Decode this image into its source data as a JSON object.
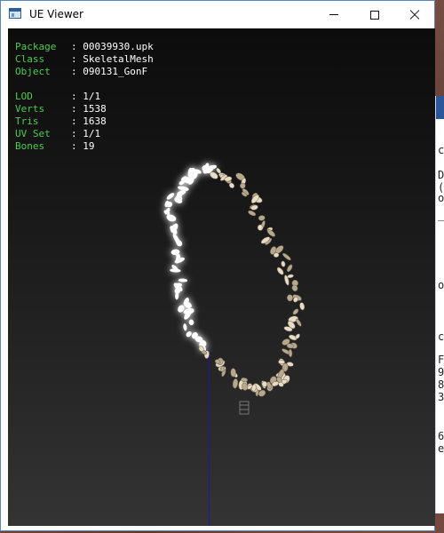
{
  "window": {
    "title": "UE Viewer",
    "controls": {
      "minimize": "minimize",
      "maximize": "maximize",
      "close": "close"
    }
  },
  "info": {
    "package": {
      "label": "Package",
      "value": "00039930.upk"
    },
    "class": {
      "label": "Class",
      "value": "SkeletalMesh"
    },
    "object": {
      "label": "Object",
      "value": "090131_GonF"
    },
    "lod": {
      "label": "LOD",
      "value": "1/1"
    },
    "verts": {
      "label": "Verts",
      "value": "1538"
    },
    "tris": {
      "label": "Tris",
      "value": "1638"
    },
    "uvset": {
      "label": "UV Set",
      "value": "1/1"
    },
    "bones": {
      "label": "Bones",
      "value": "19"
    }
  },
  "colors": {
    "info_label": "#4ecb4e",
    "info_value": "#ffffff",
    "axis": "#1a1aa8",
    "petal": "#e8dcc6",
    "titlebar_bg": "#ffffff"
  },
  "background_window": {
    "fragments": [
      "c",
      "D",
      "(",
      "o",
      "-",
      "o",
      "c",
      "F",
      "9",
      "8",
      "3",
      "6",
      "e"
    ]
  },
  "icons": {
    "app": "window-icon",
    "minimize": "minimize-icon",
    "maximize": "maximize-icon",
    "close": "close-icon"
  }
}
